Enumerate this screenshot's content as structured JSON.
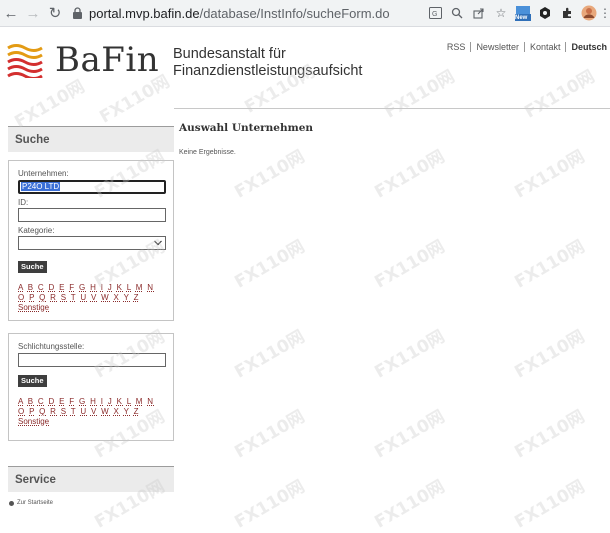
{
  "browser": {
    "url_host": "portal.mvp.bafin.de",
    "url_path": "/database/InstInfo/sucheForm.do",
    "new_badge": "New"
  },
  "header": {
    "logo_text": "BaFin",
    "org_line1": "Bundesanstalt für",
    "org_line2": "Finanzdienstleistungsaufsicht",
    "links": [
      "RSS",
      "Newsletter",
      "Kontakt",
      "Deutsch"
    ]
  },
  "sidebar": {
    "suche_title": "Suche",
    "unternehmen_label": "Unternehmen:",
    "unternehmen_value": "P24O LTD",
    "id_label": "ID:",
    "id_value": "",
    "kategorie_label": "Kategorie:",
    "kategorie_value": "",
    "suche_button": "Suche",
    "alpha_row1": [
      "A",
      "B",
      "C",
      "D",
      "E",
      "F",
      "G",
      "H",
      "I",
      "J",
      "K",
      "L",
      "M",
      "N"
    ],
    "alpha_row2": [
      "O",
      "P",
      "Q",
      "R",
      "S",
      "T",
      "U",
      "V",
      "W",
      "X",
      "Y",
      "Z"
    ],
    "sonstige": "Sonstige",
    "schlichtung_label": "Schlichtungsstelle:",
    "schlichtung_value": "",
    "suche_button2": "Suche",
    "service_title": "Service",
    "service_item": "Zur Startseite"
  },
  "main": {
    "title": "Auswahl Unternehmen",
    "message": "Keine Ergebnisse."
  },
  "watermark": "FX110网"
}
